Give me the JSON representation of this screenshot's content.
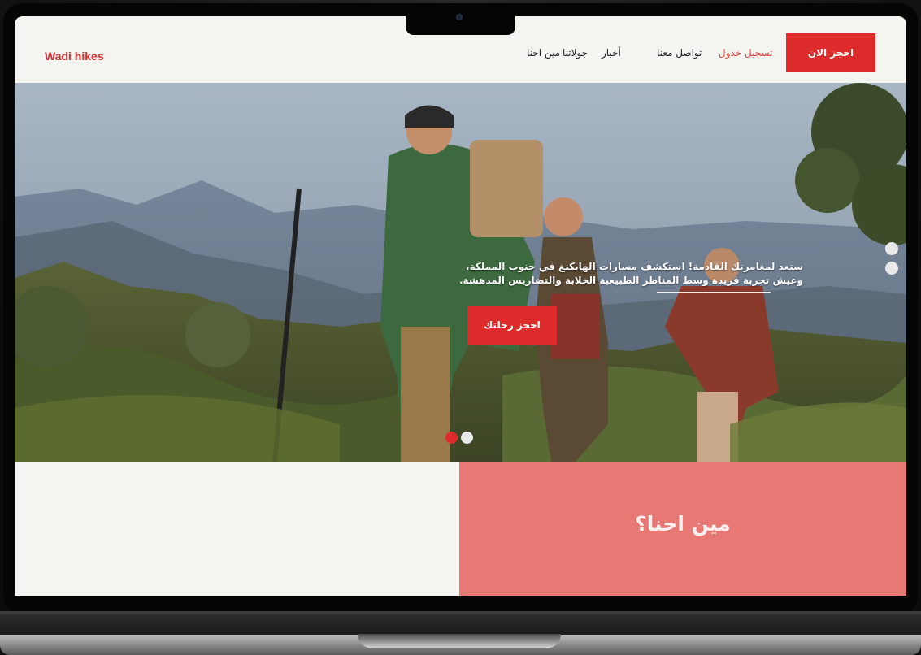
{
  "brand": {
    "logo_text": "Wadi hikes",
    "accent_color": "#dd2a2a",
    "about_bg_color": "#e77874"
  },
  "nav": {
    "items": [
      {
        "label": "مين احنا"
      },
      {
        "label": "جولاتنا"
      },
      {
        "label": "أخبار"
      },
      {
        "label": "تواصل معنا"
      },
      {
        "label": "تسجيل خدول"
      }
    ],
    "cta_label": "احجز الان"
  },
  "hero": {
    "line1": "ستعد لمغامرتك القادمة! استكشف مسارات الهايكنغ في جنوب المملكة،",
    "line2": "وعيش تجربة فريدة وسط المناظر الطبيعية الخلابة والتضاريس المدهشة.",
    "button_label": "احجز رحلتك",
    "carousel_active_index": 0,
    "carousel_count": 2
  },
  "about": {
    "title": "مين احنا؟"
  }
}
